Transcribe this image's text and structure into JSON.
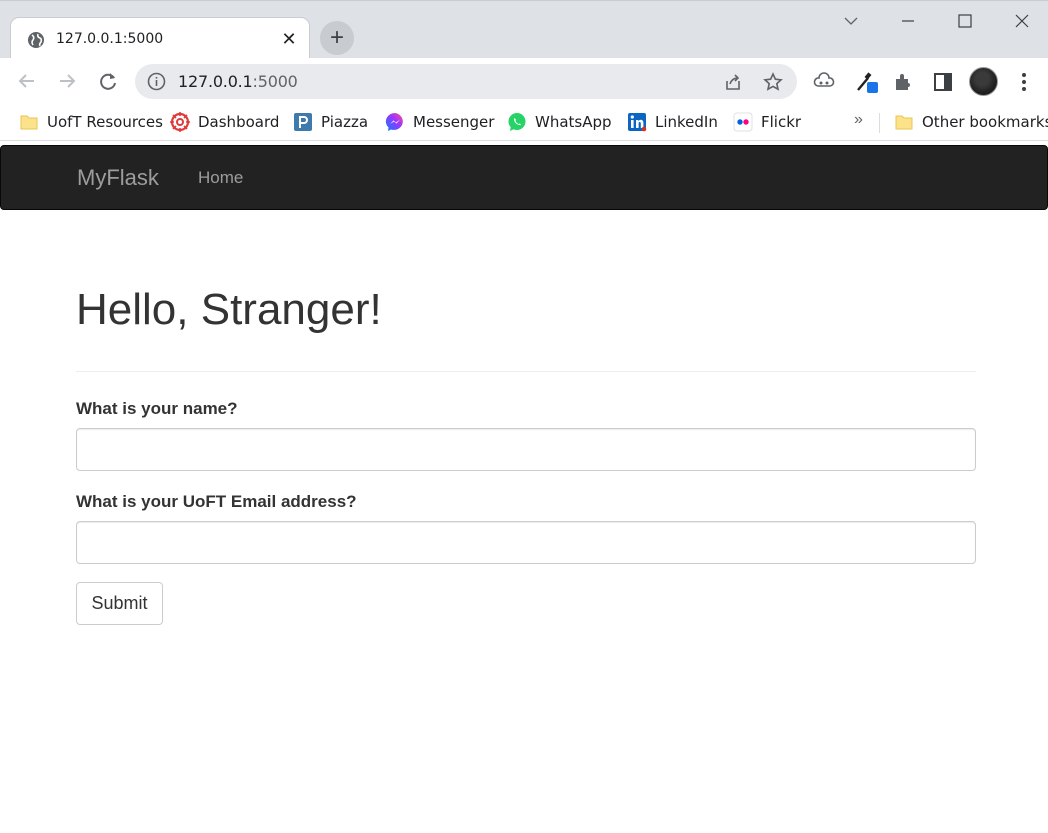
{
  "browser": {
    "tab": {
      "title": "127.0.0.1:5000",
      "favicon": "globe-icon"
    },
    "address": {
      "host": "127.0.0.1",
      "port": ":5000"
    },
    "bookmarks": [
      {
        "label": "UofT Resources",
        "icon": "folder-icon"
      },
      {
        "label": "Dashboard",
        "icon": "dashboard-icon"
      },
      {
        "label": "Piazza",
        "icon": "piazza-icon"
      },
      {
        "label": "Messenger",
        "icon": "messenger-icon"
      },
      {
        "label": "WhatsApp",
        "icon": "whatsapp-icon"
      },
      {
        "label": "LinkedIn",
        "icon": "linkedin-icon"
      },
      {
        "label": "Flickr",
        "icon": "flickr-icon"
      }
    ],
    "more_bookmarks": "»",
    "other_bookmarks": "Other bookmarks"
  },
  "navbar": {
    "brand": "MyFlask",
    "links": [
      {
        "label": "Home"
      }
    ]
  },
  "page": {
    "title": "Hello, Stranger!",
    "form": {
      "name_label": "What is your name?",
      "name_value": "",
      "email_label": "What is your UoFT Email address?",
      "email_value": "",
      "submit_label": "Submit"
    }
  },
  "colors": {
    "navbar_bg": "#222222",
    "navbar_text": "#9d9d9d",
    "chrome_bg": "#dee1e6"
  }
}
